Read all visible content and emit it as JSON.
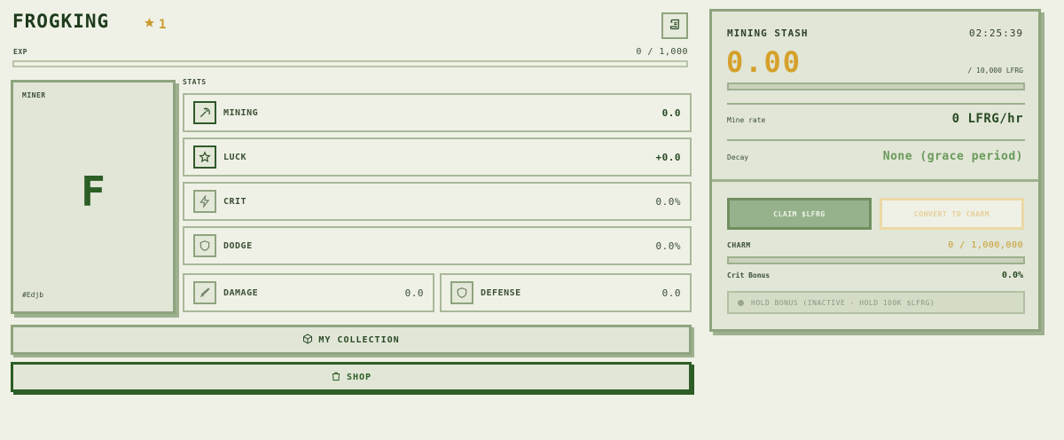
{
  "header": {
    "title": "FROGKING",
    "level": "1"
  },
  "exp": {
    "label": "EXP",
    "value": "0 / 1,000",
    "progress": 0
  },
  "miner": {
    "label": "MINER",
    "initial": "F",
    "id": "#Edjb"
  },
  "stats": {
    "label": "STATS",
    "items": [
      {
        "name": "MINING",
        "value": "0.0",
        "icon": "pickaxe-icon"
      },
      {
        "name": "LUCK",
        "value": "+0.0",
        "icon": "star-icon"
      },
      {
        "name": "CRIT",
        "value": "0.0%",
        "icon": "lightning-icon"
      },
      {
        "name": "DODGE",
        "value": "0.0%",
        "icon": "shield-icon"
      },
      {
        "name": "DAMAGE",
        "value": "0.0",
        "icon": "sword-icon"
      },
      {
        "name": "DEFENSE",
        "value": "0.0",
        "icon": "shield-icon"
      }
    ]
  },
  "buttons": {
    "collection": "MY COLLECTION",
    "shop": "SHOP"
  },
  "mining_stash": {
    "title": "MINING STASH",
    "timer": "02:25:39",
    "amount": "0.00",
    "cap": "/ 10,000 LFRG",
    "progress": 0,
    "mine_rate_label": "Mine rate",
    "mine_rate_value": "0 LFRG/hr",
    "decay_label": "Decay",
    "decay_value": "None (grace period)"
  },
  "actions": {
    "claim": "CLAIM $LFRG",
    "convert": "CONVERT TO CHARM"
  },
  "charm": {
    "label": "CHARM",
    "value": "0 / 1,000,000",
    "progress": 0,
    "crit_bonus_label": "Crit Bonus",
    "crit_bonus_value": "0.0%"
  },
  "hold_bonus": {
    "text": "HOLD BONUS (INACTIVE - HOLD 100K $LFRG)"
  },
  "colors": {
    "background": "#eff1e6",
    "accent_green": "#2c5e26",
    "gold": "#d5a12a",
    "border": "#8fa47e"
  }
}
